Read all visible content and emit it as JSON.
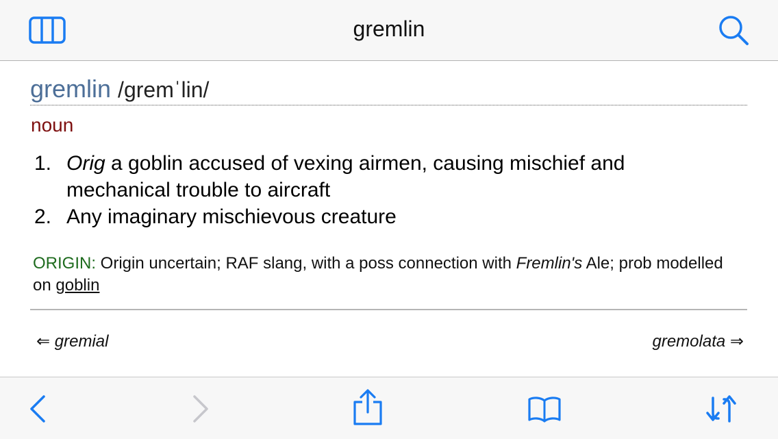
{
  "header": {
    "title": "gremlin"
  },
  "entry": {
    "headword": "gremlin",
    "pronunciation": "/gremˈlin/",
    "part_of_speech": "noun",
    "senses": [
      {
        "number": "1.",
        "label": "Orig",
        "text": " a goblin accused of vexing airmen, causing mischief and mechanical trouble to aircraft"
      },
      {
        "number": "2.",
        "label": "",
        "text": "Any imaginary mischievous creature"
      }
    ],
    "origin": {
      "label": "ORIGIN:",
      "text_before": " Origin uncertain; RAF slang, with a poss connection with ",
      "italic": "Fremlin's",
      "text_middle": " Ale; prob modelled on ",
      "xref": "goblin"
    }
  },
  "navigation": {
    "prev_arrow": "⇐",
    "prev_word": "gremial",
    "next_word": "gremolata",
    "next_arrow": "⇒"
  },
  "icons": {
    "sidebar": "sidebar-columns-icon",
    "search": "search-icon",
    "back": "back-chevron-icon",
    "forward": "forward-chevron-icon",
    "share": "share-icon",
    "bookmarks": "open-book-icon",
    "swap": "swap-arrows-icon"
  },
  "colors": {
    "accent": "#1a7cf2",
    "disabled": "#c7c7cc",
    "headword": "#4d6f98",
    "part_of_speech": "#7d0f0f",
    "origin_label": "#1e6b1e"
  }
}
